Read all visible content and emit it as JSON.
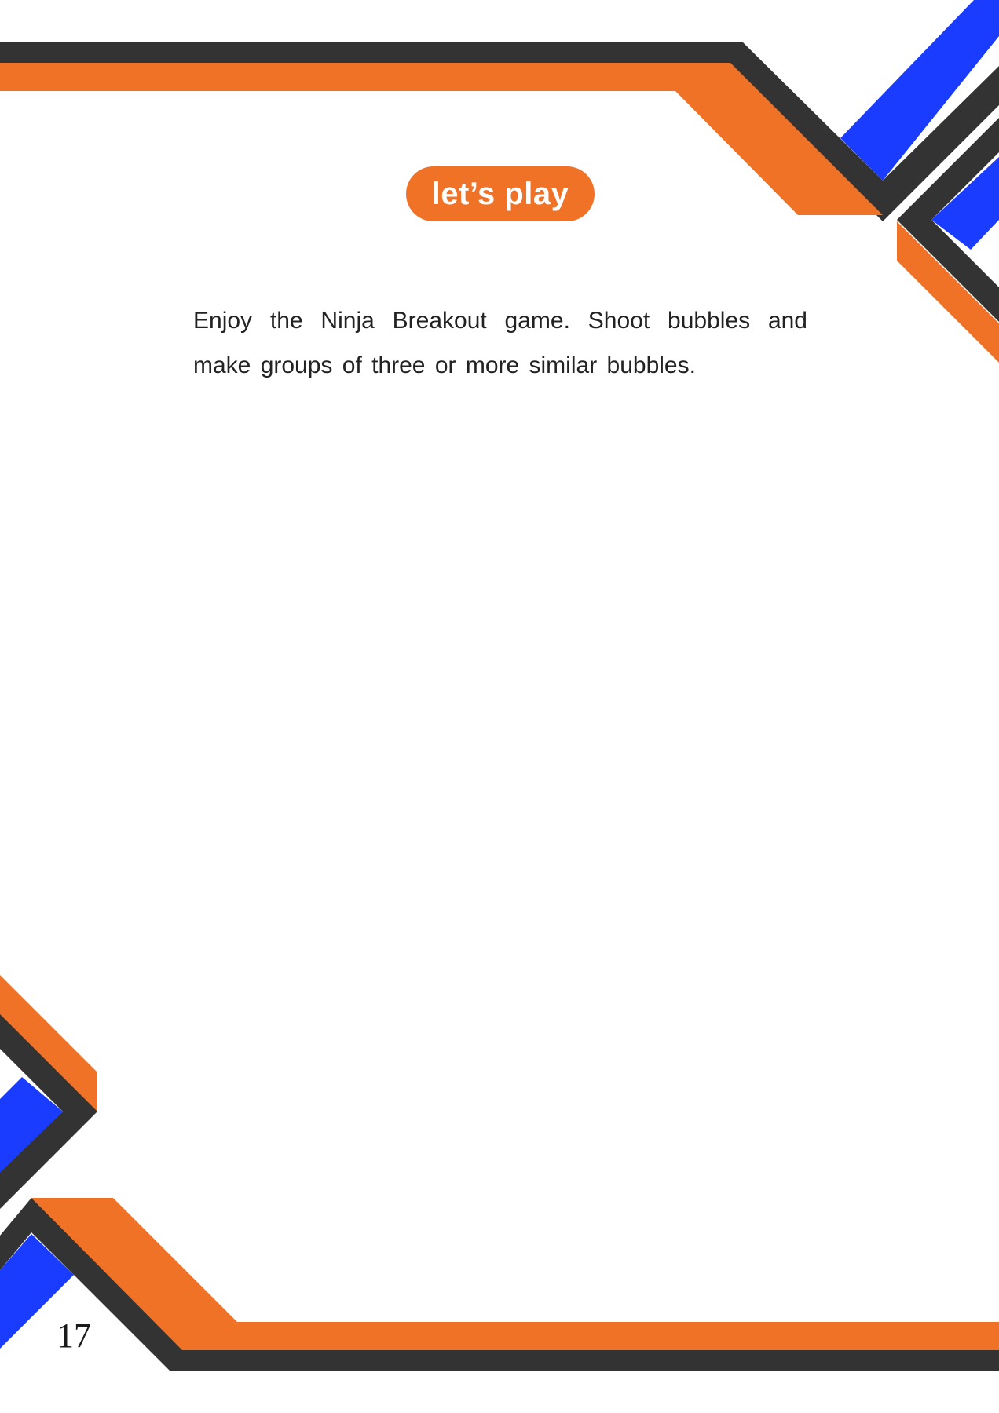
{
  "section": {
    "label": "let’s play"
  },
  "instructions": {
    "text": "Enjoy the Ninja Breakout game. Shoot bubbles and make groups of three or more similar bubbles."
  },
  "footer": {
    "page_number": "17"
  },
  "colors": {
    "orange": "#f07227",
    "dark": "#333333",
    "blue": "#1a3cff"
  }
}
